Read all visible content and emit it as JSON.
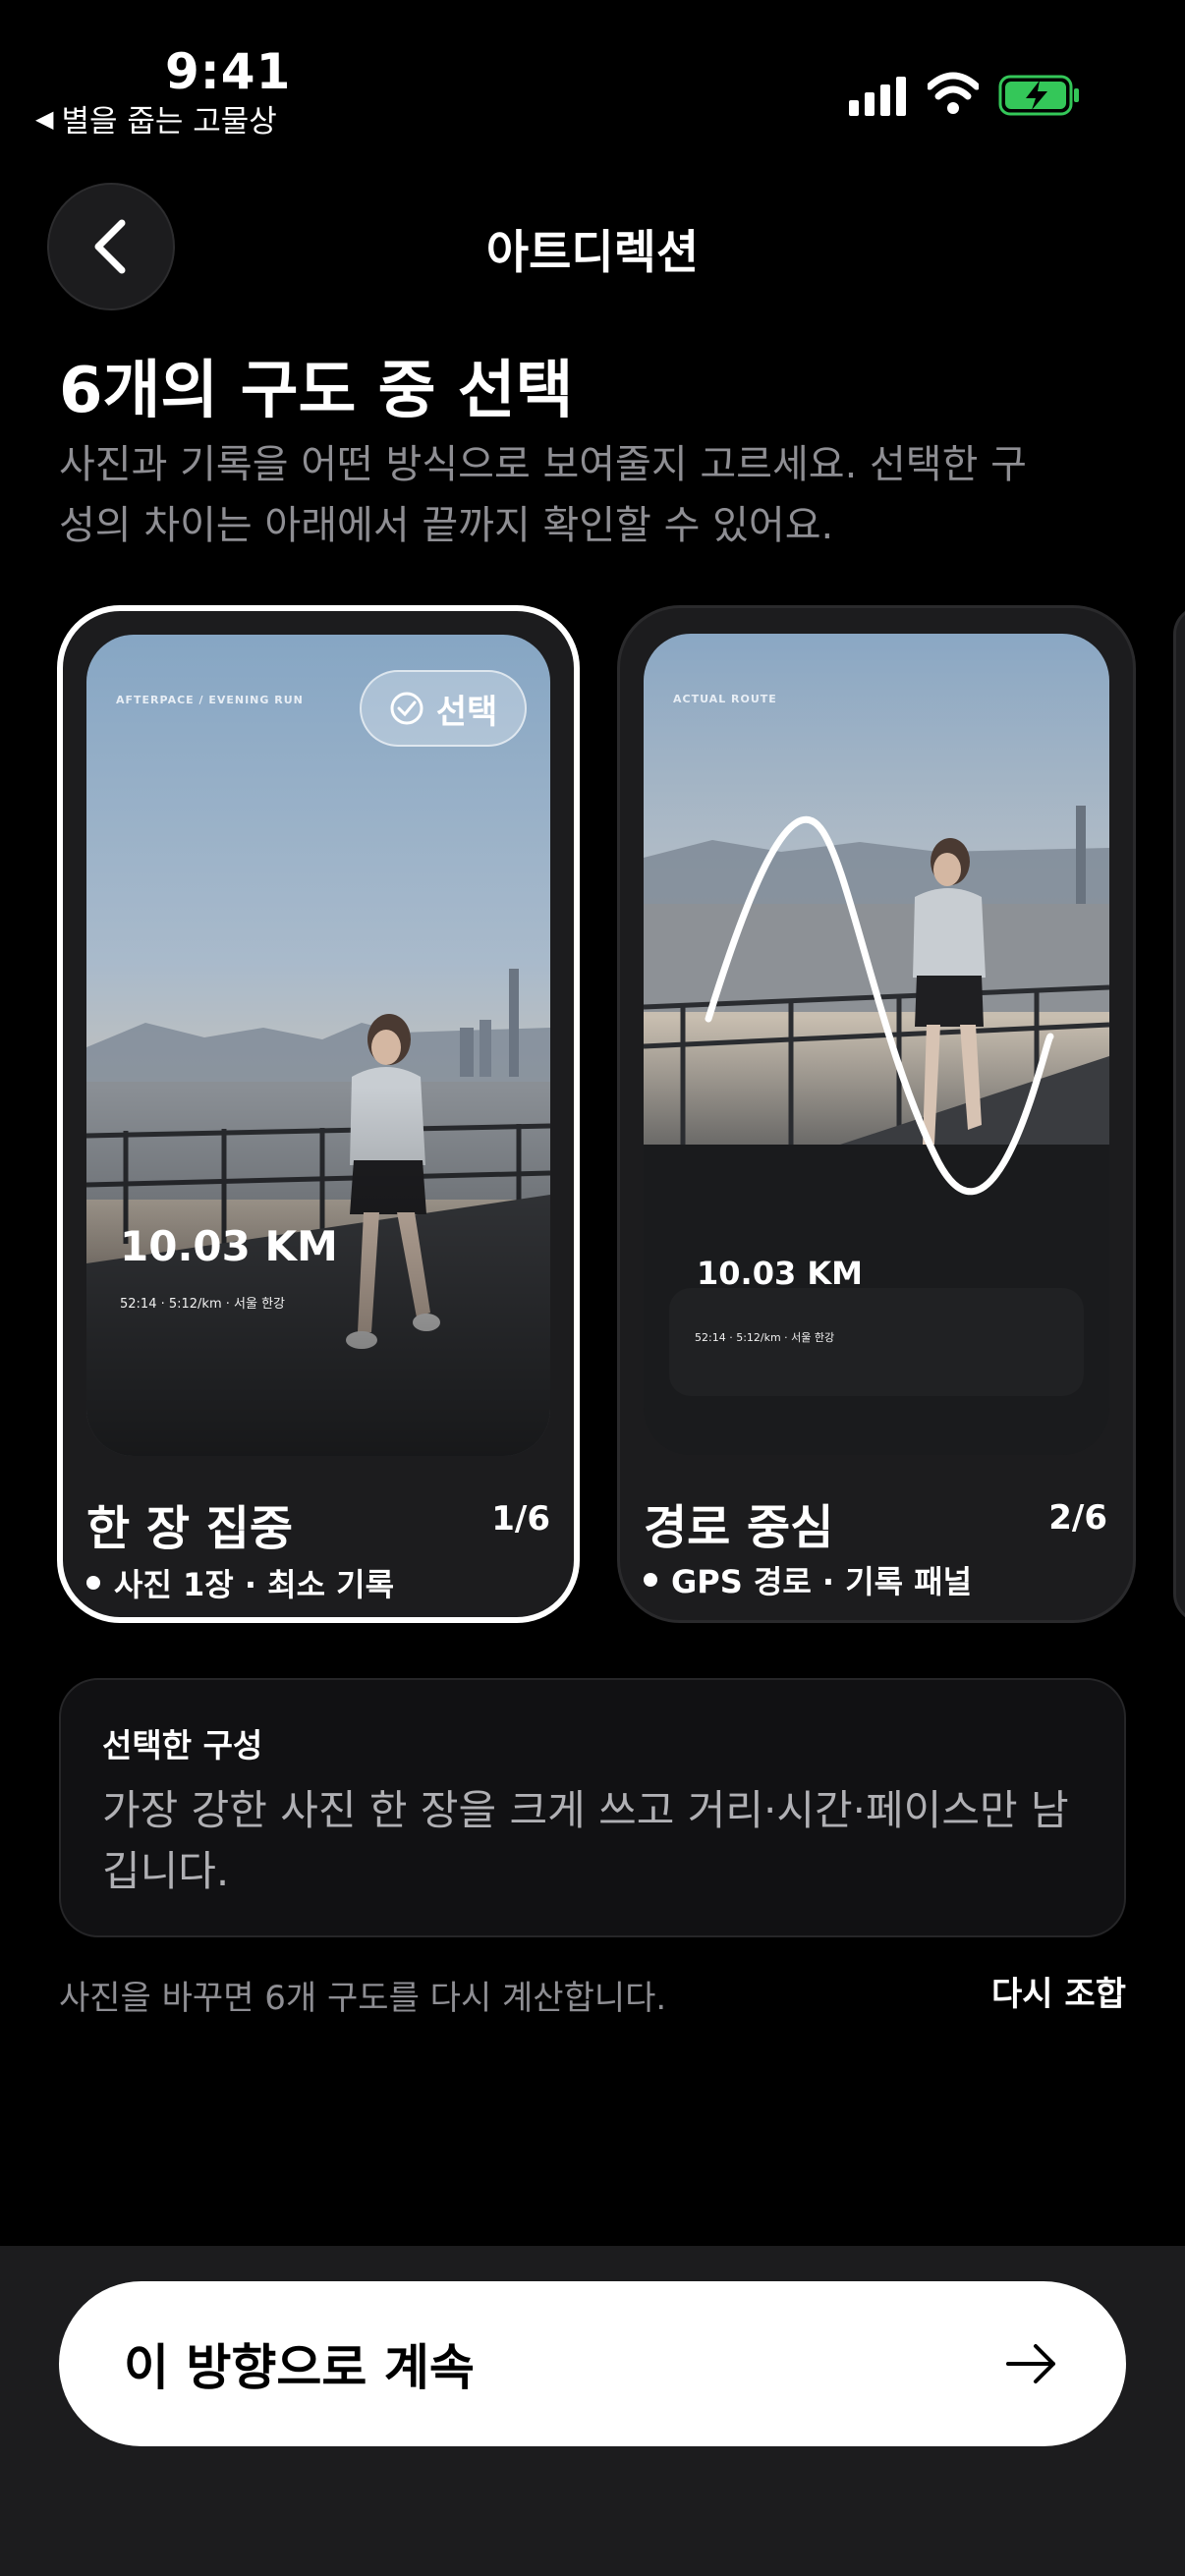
{
  "status_bar": {
    "time": "9:41",
    "back_app": "별을 줍는 고물상"
  },
  "header": {
    "title": "아트디렉션"
  },
  "heading": "6개의 구도 중 선택",
  "description": "사진과 기록을 어떤 방식으로 보여줄지 고르세요. 선택한 구성의 차이는 아래에서 끝까지 확인할 수 있어요.",
  "cards": [
    {
      "overline": "AFTERPACE / EVENING RUN",
      "select_label": "선택",
      "distance": "10.03 KM",
      "stats": "52:14 · 5:12/km · 서울 한강",
      "name": "한 장 집중",
      "count": "1/6",
      "subtitle": "사진 1장 · 최소 기록"
    },
    {
      "overline": "ACTUAL ROUTE",
      "distance": "10.03 KM",
      "stats": "52:14 · 5:12/km · 서울 한강",
      "name": "경로 중심",
      "count": "2/6",
      "subtitle": "GPS 경로 · 기록 패널"
    }
  ],
  "selected_info": {
    "title": "선택한 구성",
    "text": "가장 강한 사진 한 장을 크게 쓰고 거리·시간·페이스만 남깁니다."
  },
  "hint": "사진을 바꾸면 6개 구도를 다시 계산합니다.",
  "reshuffle_label": "다시 조합",
  "continue_label": "이 방향으로 계속",
  "colors": {
    "background": "#000000",
    "card": "#1c1c1e",
    "battery": "#34c759"
  }
}
